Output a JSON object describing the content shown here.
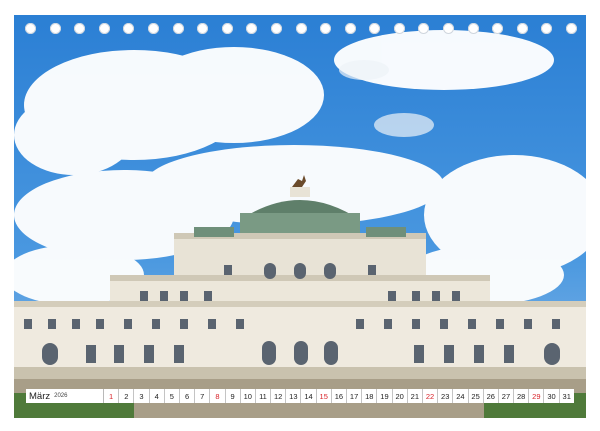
{
  "calendar": {
    "month": "März",
    "year": "2026",
    "days": [
      {
        "label": "1",
        "sunday": true
      },
      {
        "label": "2",
        "sunday": false
      },
      {
        "label": "3",
        "sunday": false
      },
      {
        "label": "4",
        "sunday": false
      },
      {
        "label": "5",
        "sunday": false
      },
      {
        "label": "6",
        "sunday": false
      },
      {
        "label": "7",
        "sunday": false
      },
      {
        "label": "8",
        "sunday": true
      },
      {
        "label": "9",
        "sunday": false
      },
      {
        "label": "10",
        "sunday": false
      },
      {
        "label": "11",
        "sunday": false
      },
      {
        "label": "12",
        "sunday": false
      },
      {
        "label": "13",
        "sunday": false
      },
      {
        "label": "14",
        "sunday": false
      },
      {
        "label": "15",
        "sunday": true
      },
      {
        "label": "16",
        "sunday": false
      },
      {
        "label": "17",
        "sunday": false
      },
      {
        "label": "18",
        "sunday": false
      },
      {
        "label": "19",
        "sunday": false
      },
      {
        "label": "20",
        "sunday": false
      },
      {
        "label": "21",
        "sunday": false
      },
      {
        "label": "22",
        "sunday": true
      },
      {
        "label": "23",
        "sunday": false
      },
      {
        "label": "24",
        "sunday": false
      },
      {
        "label": "25",
        "sunday": false
      },
      {
        "label": "26",
        "sunday": false
      },
      {
        "label": "27",
        "sunday": false
      },
      {
        "label": "28",
        "sunday": false
      },
      {
        "label": "29",
        "sunday": true
      },
      {
        "label": "30",
        "sunday": false
      },
      {
        "label": "31",
        "sunday": false
      }
    ]
  },
  "binding": {
    "hole_count": 23
  },
  "colors": {
    "sunday": "#d8232a",
    "sky": "#3a8ad8",
    "facade": "#e8e3d6",
    "dome": "#5f7f6a"
  }
}
